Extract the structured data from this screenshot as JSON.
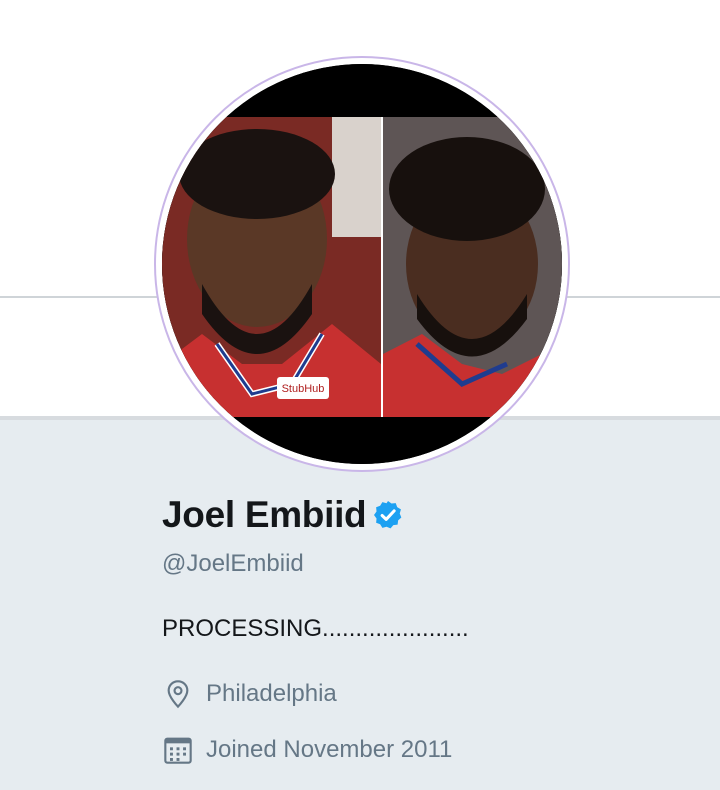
{
  "profile": {
    "name": "Joel Embiid",
    "handle": "@JoelEmbiid",
    "bio": "PROCESSING......................",
    "location": "Philadelphia",
    "joined": "Joined November 2011",
    "verified": true,
    "jersey_sponsor": "StubHub"
  },
  "colors": {
    "verified_blue": "#1da1f2",
    "avatar_ring": "#c9b6e8",
    "muted_text": "#657786",
    "profile_bg": "#e6ecf0"
  },
  "icons": {
    "location": "location-pin-icon",
    "joined": "calendar-icon",
    "verified": "verified-badge-icon"
  }
}
